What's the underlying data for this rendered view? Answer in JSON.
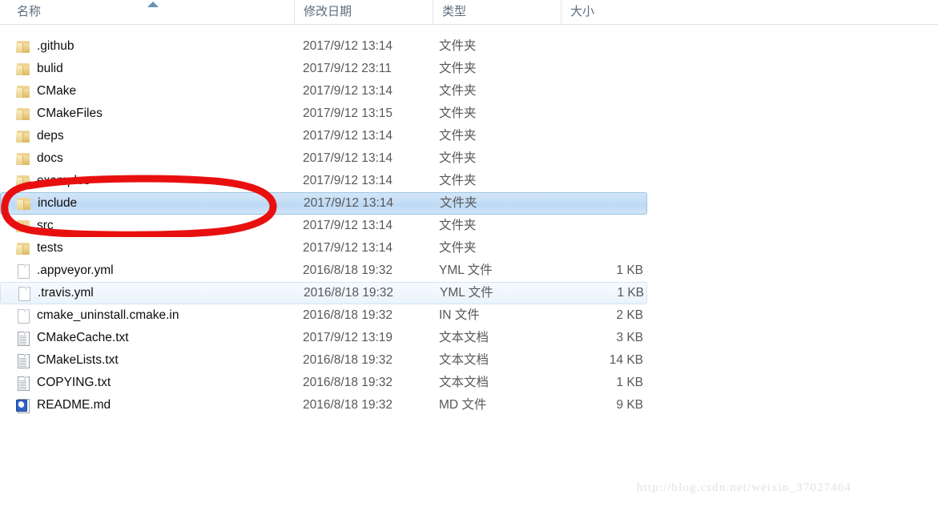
{
  "window": {
    "type": "file-explorer",
    "watermark": "http://blog.csdn.net/weixin_37027464"
  },
  "columns": {
    "name": "名称",
    "date_modified": "修改日期",
    "type": "类型",
    "size": "大小",
    "sort_column": "名称",
    "sort_direction": "ascending"
  },
  "colors": {
    "selection": "#c3dcf5",
    "selection_border": "#9cc4e4",
    "hover": "#eaf3fc",
    "annotation": "#e8100f",
    "folder": "#e8cf8d",
    "header_text": "#5d6c7d"
  },
  "annotation": {
    "shape": "ellipse",
    "target_row": "include",
    "color": "#e8100f"
  },
  "rows": [
    {
      "name": ".github",
      "date": "2017/9/12 13:14",
      "type": "文件夹",
      "size": "",
      "icon": "folder-icon",
      "state": "normal"
    },
    {
      "name": "bulid",
      "date": "2017/9/12 23:11",
      "type": "文件夹",
      "size": "",
      "icon": "folder-icon",
      "state": "normal"
    },
    {
      "name": "CMake",
      "date": "2017/9/12 13:14",
      "type": "文件夹",
      "size": "",
      "icon": "folder-icon",
      "state": "normal"
    },
    {
      "name": "CMakeFiles",
      "date": "2017/9/12 13:15",
      "type": "文件夹",
      "size": "",
      "icon": "folder-icon",
      "state": "normal"
    },
    {
      "name": "deps",
      "date": "2017/9/12 13:14",
      "type": "文件夹",
      "size": "",
      "icon": "folder-icon",
      "state": "normal"
    },
    {
      "name": "docs",
      "date": "2017/9/12 13:14",
      "type": "文件夹",
      "size": "",
      "icon": "folder-icon",
      "state": "normal"
    },
    {
      "name": "examples",
      "date": "2017/9/12 13:14",
      "type": "文件夹",
      "size": "",
      "icon": "folder-icon",
      "state": "normal"
    },
    {
      "name": "include",
      "date": "2017/9/12 13:14",
      "type": "文件夹",
      "size": "",
      "icon": "folder-icon",
      "state": "selected"
    },
    {
      "name": "src",
      "date": "2017/9/12 13:14",
      "type": "文件夹",
      "size": "",
      "icon": "folder-icon",
      "state": "normal"
    },
    {
      "name": "tests",
      "date": "2017/9/12 13:14",
      "type": "文件夹",
      "size": "",
      "icon": "folder-icon",
      "state": "normal"
    },
    {
      "name": ".appveyor.yml",
      "date": "2016/8/18 19:32",
      "type": "YML 文件",
      "size": "1 KB",
      "icon": "file-icon",
      "state": "normal"
    },
    {
      "name": ".travis.yml",
      "date": "2016/8/18 19:32",
      "type": "YML 文件",
      "size": "1 KB",
      "icon": "file-icon",
      "state": "hovered"
    },
    {
      "name": "cmake_uninstall.cmake.in",
      "date": "2016/8/18 19:32",
      "type": "IN 文件",
      "size": "2 KB",
      "icon": "file-icon",
      "state": "normal"
    },
    {
      "name": "CMakeCache.txt",
      "date": "2017/9/12 13:19",
      "type": "文本文档",
      "size": "3 KB",
      "icon": "text-document-icon",
      "state": "normal"
    },
    {
      "name": "CMakeLists.txt",
      "date": "2016/8/18 19:32",
      "type": "文本文档",
      "size": "14 KB",
      "icon": "text-document-icon",
      "state": "normal"
    },
    {
      "name": "COPYING.txt",
      "date": "2016/8/18 19:32",
      "type": "文本文档",
      "size": "1 KB",
      "icon": "text-document-icon",
      "state": "normal"
    },
    {
      "name": "README.md",
      "date": "2016/8/18 19:32",
      "type": "MD 文件",
      "size": "9 KB",
      "icon": "markdown-file-icon",
      "state": "normal"
    }
  ]
}
